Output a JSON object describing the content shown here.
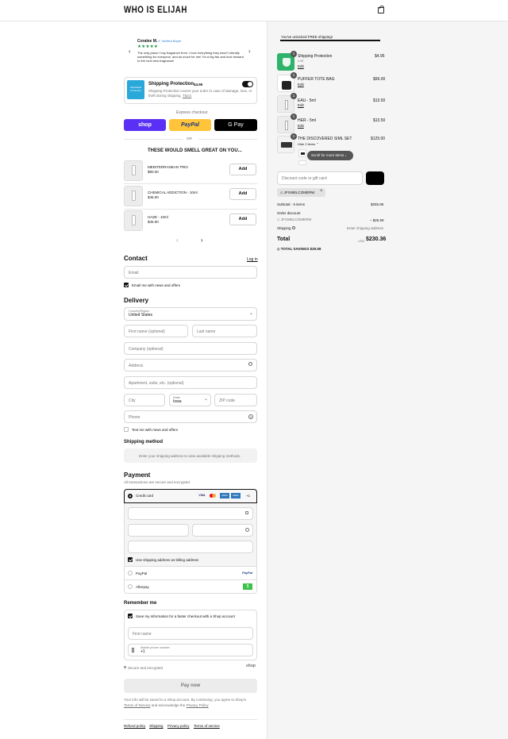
{
  "header": {
    "logo": "WHO IS ELIJAH"
  },
  "review": {
    "name": "Coralee M.",
    "badge": "Verified Buyer",
    "stars": "★★★★★",
    "text": "The only place I buy fragrance from. I love everything they have! Literally something for everyone, and as much for me! I'm a big fan and look forward to the next new fragrance!"
  },
  "protection": {
    "title": "Shipping Protection",
    "price": "$4.95",
    "desc": "Shipping Protection covers your order in case of damage, loss, or theft during shipping.",
    "tcs": "T&Cs",
    "logo_text": "ShipShield Protection"
  },
  "express": {
    "label": "Express checkout",
    "shop": "shop",
    "paypal": "PayPal",
    "gpay": "G Pay",
    "or": "OR"
  },
  "upsell": {
    "heading": "THESE WOULD SMELL GREAT ON YOU...",
    "add_label": "Add",
    "items": [
      {
        "name": "MEDITERRANEAN TRIO",
        "price": "$90.00"
      },
      {
        "name": "CHEMICAL ADDICTION - 10ml",
        "price": "$45.00"
      },
      {
        "name": "HAZE - 10ml",
        "price": "$45.00"
      }
    ]
  },
  "contact": {
    "heading": "Contact",
    "login": "Log in",
    "email_placeholder": "Email",
    "news_label": "Email me with news and offers"
  },
  "delivery": {
    "heading": "Delivery",
    "country_label": "Country/Region",
    "country_value": "United States",
    "first_name": "First name (optional)",
    "last_name": "Last name",
    "company": "Company (optional)",
    "address": "Address",
    "apartment": "Apartment, suite, etc. (optional)",
    "city": "City",
    "state_label": "State",
    "state_value": "Iowa",
    "zip": "ZIP code",
    "phone": "Phone",
    "text_label": "Text me with news and offers"
  },
  "shipping_method": {
    "heading": "Shipping method",
    "note": "Enter your shipping address to view available shipping methods."
  },
  "payment": {
    "heading": "Payment",
    "sub": "All transactions are secure and encrypted.",
    "credit_card": "Credit card",
    "more": "+1",
    "billing_label": "Use shipping address as billing address",
    "paypal": "PayPal",
    "afterpay": "Afterpay",
    "card_brands": [
      "VISA",
      "MC",
      "AMEX",
      "AMEX"
    ]
  },
  "remember": {
    "heading": "Remember me",
    "save_label": "Save my information for a faster checkout with a Shop account",
    "first_name": "First name",
    "phone_label": "Mobile phone number",
    "phone_value": "+1",
    "secure": "Secure and encrypted",
    "shop": "shop"
  },
  "pay": {
    "button": "Pay now",
    "legal_1": "Your info will be saved to a Shop account. By continuing, you agree to Shop's",
    "terms": "Terms of Service",
    "and": "and acknowledge the",
    "privacy": "Privacy Policy"
  },
  "footer": {
    "links": [
      "Refund policy",
      "Shipping",
      "Privacy policy",
      "Terms of service"
    ]
  },
  "summary": {
    "free_shipping": "You've unlocked FREE shipping!",
    "free_progress": 1.0,
    "edit": "Edit",
    "items": [
      {
        "qty": "1",
        "name": "Shipping Protection",
        "sub": "4.95",
        "price": "$4.95"
      },
      {
        "qty": "1",
        "name": "PUFFER TOTE BAG",
        "sub": "",
        "price": "$99.00"
      },
      {
        "qty": "1",
        "name": "EAU - 5ml",
        "sub": "",
        "price": "$13.50"
      },
      {
        "qty": "1",
        "name": "HER - 5ml",
        "sub": "",
        "price": "$13.50"
      },
      {
        "qty": "1",
        "name": "THE DISCOVERED SIML SET",
        "sub": "Hide 2 items",
        "price": "$125.00"
      }
    ],
    "scroll_more": "Scroll for more items",
    "discount_placeholder": "Discount code or gift card",
    "code_tag": "JFXWELCOMERW",
    "subtotal_label": "Subtotal · 5 items",
    "subtotal_value": "$255.95",
    "order_discount_label": "Order discount",
    "discount_code": "JFXWELCOMERW",
    "discount_value": "– $25.59",
    "shipping_label": "Shipping",
    "shipping_value": "Enter shipping address",
    "total_label": "Total",
    "currency": "USD",
    "total_value": "$230.36",
    "savings_label": "TOTAL SAVINGS",
    "savings_value": "$25.59"
  },
  "colors": {
    "shop_purple": "#5a31f4",
    "paypal_yellow": "#ffc439",
    "gpay_black": "#000000",
    "protect_green": "#2fb36b",
    "afterpay_green": "#3cc14a"
  }
}
